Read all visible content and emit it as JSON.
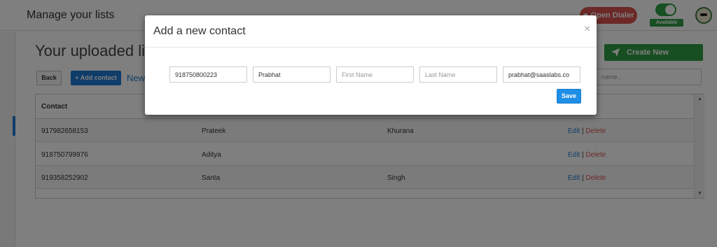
{
  "app": {
    "title": "Manage your lists"
  },
  "header": {
    "dialer_label": "Open Dialer",
    "availability": {
      "label": "Available",
      "on": true
    },
    "colors": {
      "dialer": "#d9534f",
      "available": "#2e9d44"
    },
    "avatar_icon": "user-avatar-icon"
  },
  "page": {
    "heading": "Your uploaded lis",
    "create_campaign_label": "Create New Campaign",
    "create_campaign_icon": "send-icon",
    "back_label": "Back",
    "add_contact_label": "+ Add contact",
    "new_link_label": "New",
    "search_value": "name.."
  },
  "table": {
    "columns": [
      "Contact"
    ],
    "rows": [
      {
        "number": "917982658153",
        "first_name": "Prateek",
        "last_name": "Khurana",
        "edit": "Edit",
        "sep": " | ",
        "delete": "Delete"
      },
      {
        "number": "918750799976",
        "first_name": "Aditya",
        "last_name": "",
        "edit": "Edit",
        "sep": " | ",
        "delete": "Delete"
      },
      {
        "number": "919358252902",
        "first_name": "Santa",
        "last_name": "Singh",
        "edit": "Edit",
        "sep": " | ",
        "delete": "Delete"
      }
    ]
  },
  "modal": {
    "title": "Add a new contact",
    "close_label": "×",
    "fields": {
      "phone": {
        "value": "918750800223",
        "placeholder": ""
      },
      "name": {
        "value": "Prabhat",
        "placeholder": ""
      },
      "first_name": {
        "value": "",
        "placeholder": "First Name"
      },
      "last_name": {
        "value": "",
        "placeholder": "Last Name"
      },
      "email": {
        "value": "prabhat@saaslabs.co",
        "placeholder": ""
      }
    },
    "save_label": "Save",
    "accent_color": "#1e8fe6"
  }
}
